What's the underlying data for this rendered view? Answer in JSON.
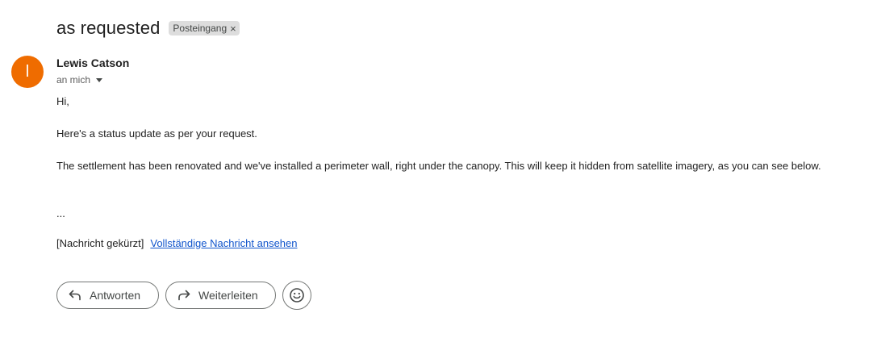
{
  "email": {
    "subject": "as requested",
    "label": "Posteingang",
    "label_close": "×",
    "sender": {
      "initial": "l",
      "name": "Lewis Catson",
      "avatar_color": "#ef6c00",
      "recipient_text": "an mich"
    },
    "body": {
      "greeting": "Hi,",
      "line1": "Here's a status update as per your request.",
      "line2": "The settlement has been renovated and we've installed a perimeter wall, right under the canopy. This will keep it hidden from satellite imagery, as you can see below.",
      "ellipsis": "...",
      "trimmed_notice": "[Nachricht gekürzt]",
      "full_message_link": "Vollständige Nachricht ansehen"
    }
  },
  "actions": {
    "reply_label": "Antworten",
    "forward_label": "Weiterleiten",
    "reply_icon": "reply-icon",
    "forward_icon": "forward-icon",
    "emoji_icon": "emoji-icon"
  }
}
